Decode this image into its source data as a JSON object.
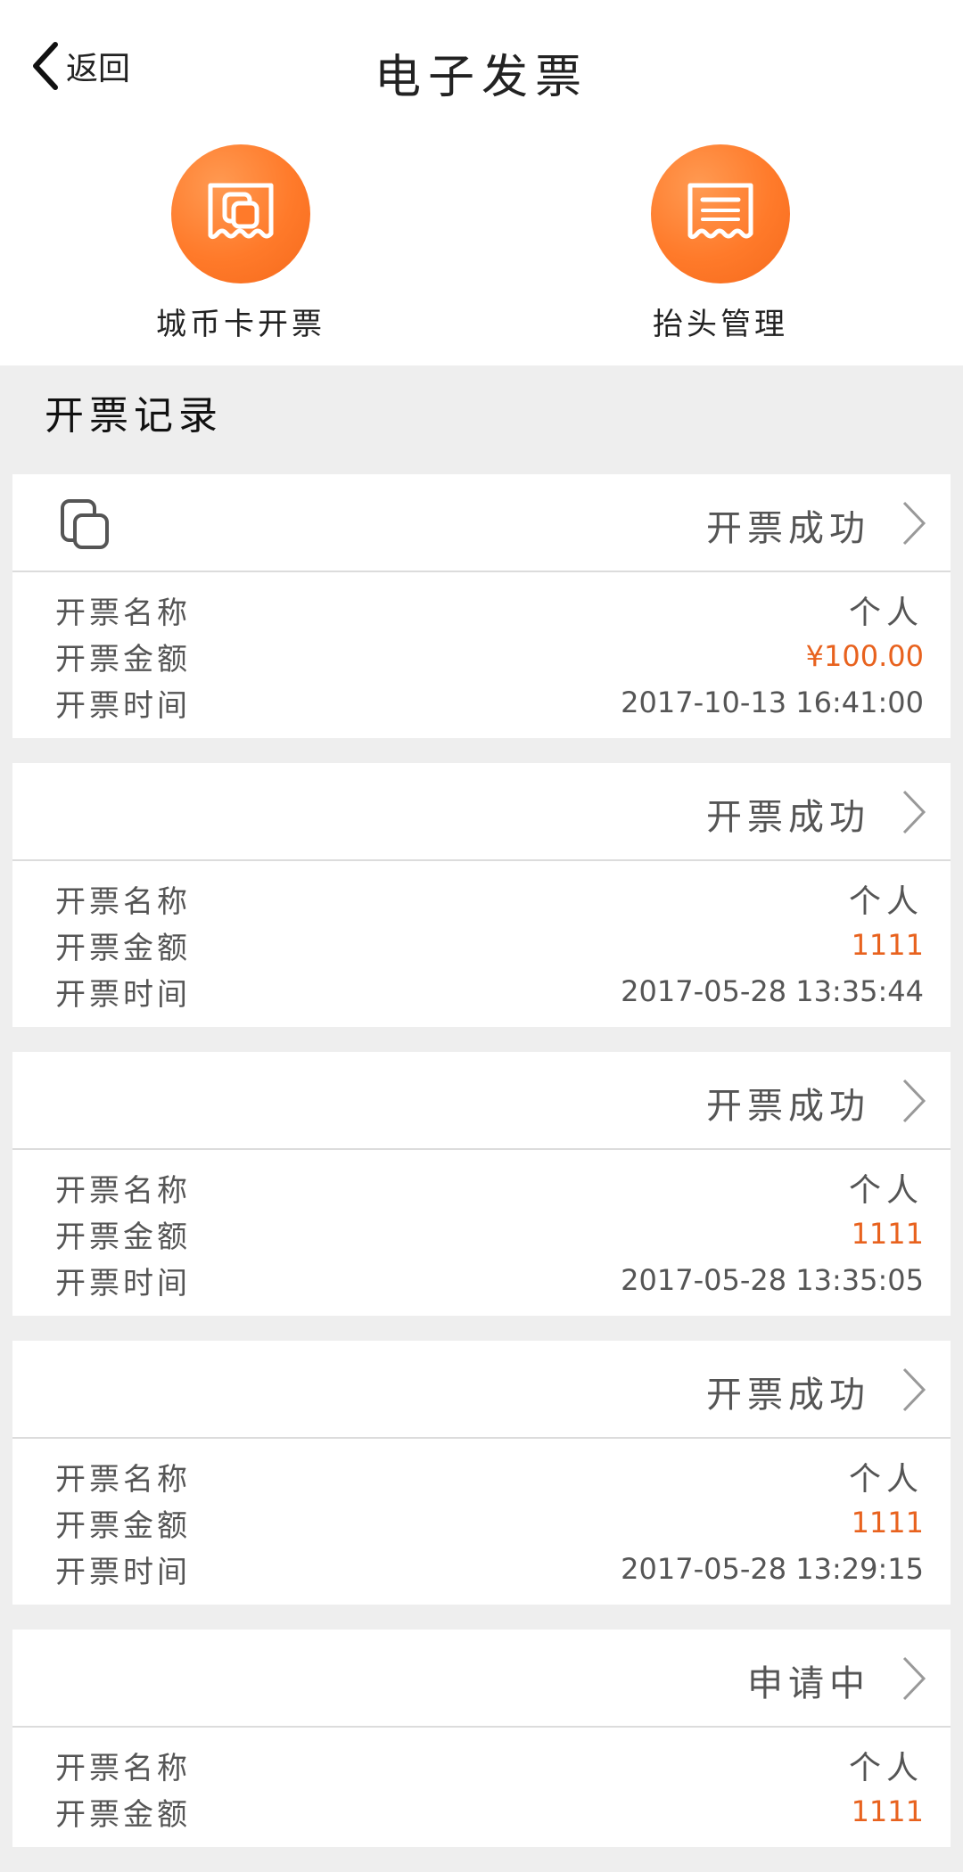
{
  "header": {
    "back_label": "返回",
    "title": "电子发票"
  },
  "actions": [
    {
      "label": "城币卡开票",
      "icon": "card-copy-icon"
    },
    {
      "label": "抬头管理",
      "icon": "receipt-lines-icon"
    }
  ],
  "section": {
    "title": "开票记录"
  },
  "labels": {
    "name": "开票名称",
    "amount": "开票金额",
    "time": "开票时间"
  },
  "records": [
    {
      "status": "开票成功",
      "name": "个人",
      "amount": "¥100.00",
      "time": "2017-10-13 16:41:00",
      "has_icon": true
    },
    {
      "status": "开票成功",
      "name": "个人",
      "amount": "1111",
      "time": "2017-05-28 13:35:44",
      "has_icon": false
    },
    {
      "status": "开票成功",
      "name": "个人",
      "amount": "1111",
      "time": "2017-05-28 13:35:05",
      "has_icon": false
    },
    {
      "status": "开票成功",
      "name": "个人",
      "amount": "1111",
      "time": "2017-05-28 13:29:15",
      "has_icon": false
    },
    {
      "status": "申请中",
      "name": "个人",
      "amount": "1111",
      "time": "",
      "has_icon": false
    }
  ],
  "colors": {
    "accent": "#ff7a2a",
    "amount": "#e8621e",
    "background": "#eeeeee"
  }
}
